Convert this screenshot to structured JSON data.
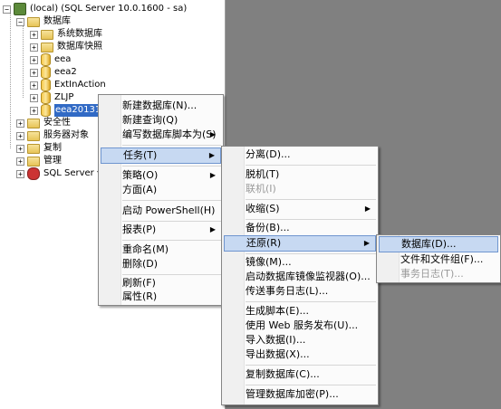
{
  "tree": {
    "root": "(local) (SQL Server 10.0.1600 - sa)",
    "databases": "数据库",
    "system_databases": "系统数据库",
    "snapshots": "数据库快照",
    "db1": "eea",
    "db2": "eea2",
    "db3": "ExtInAction",
    "db4": "ZLJP",
    "db5": "eea2013121",
    "security": "安全性",
    "server_objects": "服务器对象",
    "replication": "复制",
    "management": "管理",
    "agent": "SQL Server 代"
  },
  "menu1": {
    "new_database": "新建数据库(N)...",
    "new_query": "新建查询(Q)",
    "script_as": "编写数据库脚本为(S)",
    "tasks": "任务(T)",
    "policies": "策略(O)",
    "facets": "方面(A)",
    "powershell": "启动 PowerShell(H)",
    "reports": "报表(P)",
    "rename": "重命名(M)",
    "delete": "删除(D)",
    "refresh": "刷新(F)",
    "properties": "属性(R)"
  },
  "menu2": {
    "detach": "分离(D)...",
    "offline": "脱机(T)",
    "online": "联机(I)",
    "shrink": "收缩(S)",
    "backup": "备份(B)...",
    "restore": "还原(R)",
    "mirror": "镜像(M)...",
    "mirror_monitor": "启动数据库镜像监视器(O)...",
    "log_shipping": "传送事务日志(L)...",
    "gen_scripts": "生成脚本(E)...",
    "web_service": "使用 Web 服务发布(U)...",
    "import": "导入数据(I)...",
    "export": "导出数据(X)...",
    "copy_db": "复制数据库(C)...",
    "encryption": "管理数据库加密(P)..."
  },
  "menu3": {
    "database": "数据库(D)...",
    "files": "文件和文件组(F)...",
    "tx_log": "事务日志(T)..."
  },
  "submenu_arrow": "▶",
  "expand_plus": "+",
  "expand_minus": "−"
}
